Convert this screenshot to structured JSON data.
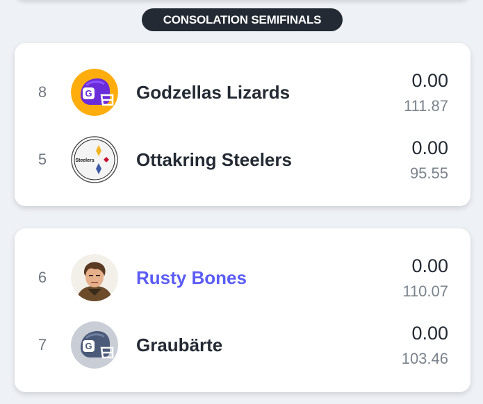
{
  "section": {
    "label": "CONSOLATION SEMIFINALS"
  },
  "matchups": [
    {
      "teams": [
        {
          "seed": "8",
          "name": "Godzellas Lizards",
          "score": "0.00",
          "projected": "111.87",
          "logo": "purple-helmet-icon",
          "highlight": false
        },
        {
          "seed": "5",
          "name": "Ottakring Steelers",
          "score": "0.00",
          "projected": "95.55",
          "logo": "steelers-logo-icon",
          "highlight": false
        }
      ]
    },
    {
      "teams": [
        {
          "seed": "6",
          "name": "Rusty Bones",
          "score": "0.00",
          "projected": "110.07",
          "logo": "character-avatar-icon",
          "highlight": true
        },
        {
          "seed": "7",
          "name": "Graubärte",
          "score": "0.00",
          "projected": "103.46",
          "logo": "gray-helmet-icon",
          "highlight": false
        }
      ]
    }
  ],
  "colors": {
    "background": "#eef1f6",
    "pill": "#232a33",
    "text_primary": "#232a33",
    "text_secondary": "#7a838c",
    "highlight": "#5b5cf6",
    "helmet_purple": "#6a2bd9",
    "helmet_purple_bg": "#ffad0d",
    "helmet_gray": "#4b5a78",
    "helmet_gray_bg": "#c9cdd6"
  }
}
